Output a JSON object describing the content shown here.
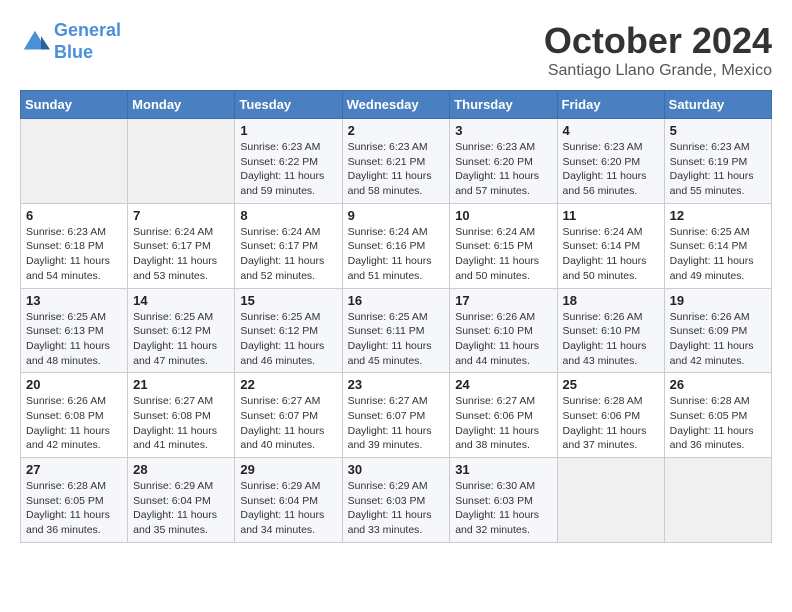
{
  "header": {
    "logo_line1": "General",
    "logo_line2": "Blue",
    "month": "October 2024",
    "location": "Santiago Llano Grande, Mexico"
  },
  "days_of_week": [
    "Sunday",
    "Monday",
    "Tuesday",
    "Wednesday",
    "Thursday",
    "Friday",
    "Saturday"
  ],
  "weeks": [
    [
      {
        "day": "",
        "info": ""
      },
      {
        "day": "",
        "info": ""
      },
      {
        "day": "1",
        "info": "Sunrise: 6:23 AM\nSunset: 6:22 PM\nDaylight: 11 hours and 59 minutes."
      },
      {
        "day": "2",
        "info": "Sunrise: 6:23 AM\nSunset: 6:21 PM\nDaylight: 11 hours and 58 minutes."
      },
      {
        "day": "3",
        "info": "Sunrise: 6:23 AM\nSunset: 6:20 PM\nDaylight: 11 hours and 57 minutes."
      },
      {
        "day": "4",
        "info": "Sunrise: 6:23 AM\nSunset: 6:20 PM\nDaylight: 11 hours and 56 minutes."
      },
      {
        "day": "5",
        "info": "Sunrise: 6:23 AM\nSunset: 6:19 PM\nDaylight: 11 hours and 55 minutes."
      }
    ],
    [
      {
        "day": "6",
        "info": "Sunrise: 6:23 AM\nSunset: 6:18 PM\nDaylight: 11 hours and 54 minutes."
      },
      {
        "day": "7",
        "info": "Sunrise: 6:24 AM\nSunset: 6:17 PM\nDaylight: 11 hours and 53 minutes."
      },
      {
        "day": "8",
        "info": "Sunrise: 6:24 AM\nSunset: 6:17 PM\nDaylight: 11 hours and 52 minutes."
      },
      {
        "day": "9",
        "info": "Sunrise: 6:24 AM\nSunset: 6:16 PM\nDaylight: 11 hours and 51 minutes."
      },
      {
        "day": "10",
        "info": "Sunrise: 6:24 AM\nSunset: 6:15 PM\nDaylight: 11 hours and 50 minutes."
      },
      {
        "day": "11",
        "info": "Sunrise: 6:24 AM\nSunset: 6:14 PM\nDaylight: 11 hours and 50 minutes."
      },
      {
        "day": "12",
        "info": "Sunrise: 6:25 AM\nSunset: 6:14 PM\nDaylight: 11 hours and 49 minutes."
      }
    ],
    [
      {
        "day": "13",
        "info": "Sunrise: 6:25 AM\nSunset: 6:13 PM\nDaylight: 11 hours and 48 minutes."
      },
      {
        "day": "14",
        "info": "Sunrise: 6:25 AM\nSunset: 6:12 PM\nDaylight: 11 hours and 47 minutes."
      },
      {
        "day": "15",
        "info": "Sunrise: 6:25 AM\nSunset: 6:12 PM\nDaylight: 11 hours and 46 minutes."
      },
      {
        "day": "16",
        "info": "Sunrise: 6:25 AM\nSunset: 6:11 PM\nDaylight: 11 hours and 45 minutes."
      },
      {
        "day": "17",
        "info": "Sunrise: 6:26 AM\nSunset: 6:10 PM\nDaylight: 11 hours and 44 minutes."
      },
      {
        "day": "18",
        "info": "Sunrise: 6:26 AM\nSunset: 6:10 PM\nDaylight: 11 hours and 43 minutes."
      },
      {
        "day": "19",
        "info": "Sunrise: 6:26 AM\nSunset: 6:09 PM\nDaylight: 11 hours and 42 minutes."
      }
    ],
    [
      {
        "day": "20",
        "info": "Sunrise: 6:26 AM\nSunset: 6:08 PM\nDaylight: 11 hours and 42 minutes."
      },
      {
        "day": "21",
        "info": "Sunrise: 6:27 AM\nSunset: 6:08 PM\nDaylight: 11 hours and 41 minutes."
      },
      {
        "day": "22",
        "info": "Sunrise: 6:27 AM\nSunset: 6:07 PM\nDaylight: 11 hours and 40 minutes."
      },
      {
        "day": "23",
        "info": "Sunrise: 6:27 AM\nSunset: 6:07 PM\nDaylight: 11 hours and 39 minutes."
      },
      {
        "day": "24",
        "info": "Sunrise: 6:27 AM\nSunset: 6:06 PM\nDaylight: 11 hours and 38 minutes."
      },
      {
        "day": "25",
        "info": "Sunrise: 6:28 AM\nSunset: 6:06 PM\nDaylight: 11 hours and 37 minutes."
      },
      {
        "day": "26",
        "info": "Sunrise: 6:28 AM\nSunset: 6:05 PM\nDaylight: 11 hours and 36 minutes."
      }
    ],
    [
      {
        "day": "27",
        "info": "Sunrise: 6:28 AM\nSunset: 6:05 PM\nDaylight: 11 hours and 36 minutes."
      },
      {
        "day": "28",
        "info": "Sunrise: 6:29 AM\nSunset: 6:04 PM\nDaylight: 11 hours and 35 minutes."
      },
      {
        "day": "29",
        "info": "Sunrise: 6:29 AM\nSunset: 6:04 PM\nDaylight: 11 hours and 34 minutes."
      },
      {
        "day": "30",
        "info": "Sunrise: 6:29 AM\nSunset: 6:03 PM\nDaylight: 11 hours and 33 minutes."
      },
      {
        "day": "31",
        "info": "Sunrise: 6:30 AM\nSunset: 6:03 PM\nDaylight: 11 hours and 32 minutes."
      },
      {
        "day": "",
        "info": ""
      },
      {
        "day": "",
        "info": ""
      }
    ]
  ]
}
